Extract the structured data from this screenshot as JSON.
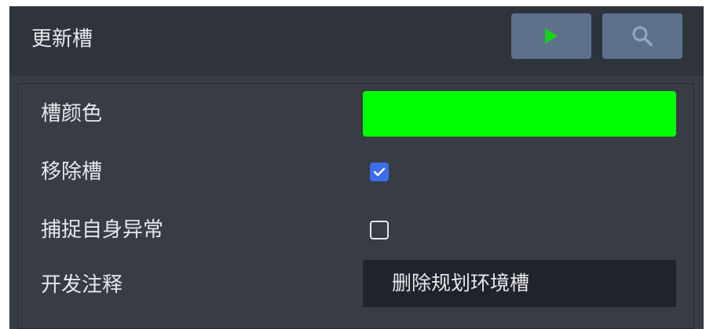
{
  "header": {
    "title": "更新槽",
    "run_icon": "play-icon",
    "search_icon": "search-icon"
  },
  "rows": {
    "slot_color": {
      "label": "槽颜色",
      "value": "#00ff00"
    },
    "remove_slot": {
      "label": "移除槽",
      "checked": true
    },
    "catch_self_exception": {
      "label": "捕捉自身异常",
      "checked": false
    },
    "dev_comment": {
      "label": "开发注释",
      "value": "删除规划环境槽"
    }
  },
  "colors": {
    "accent": "#5d718d",
    "checkbox_checked": "#3d6dea",
    "play_green": "#19d21e"
  }
}
